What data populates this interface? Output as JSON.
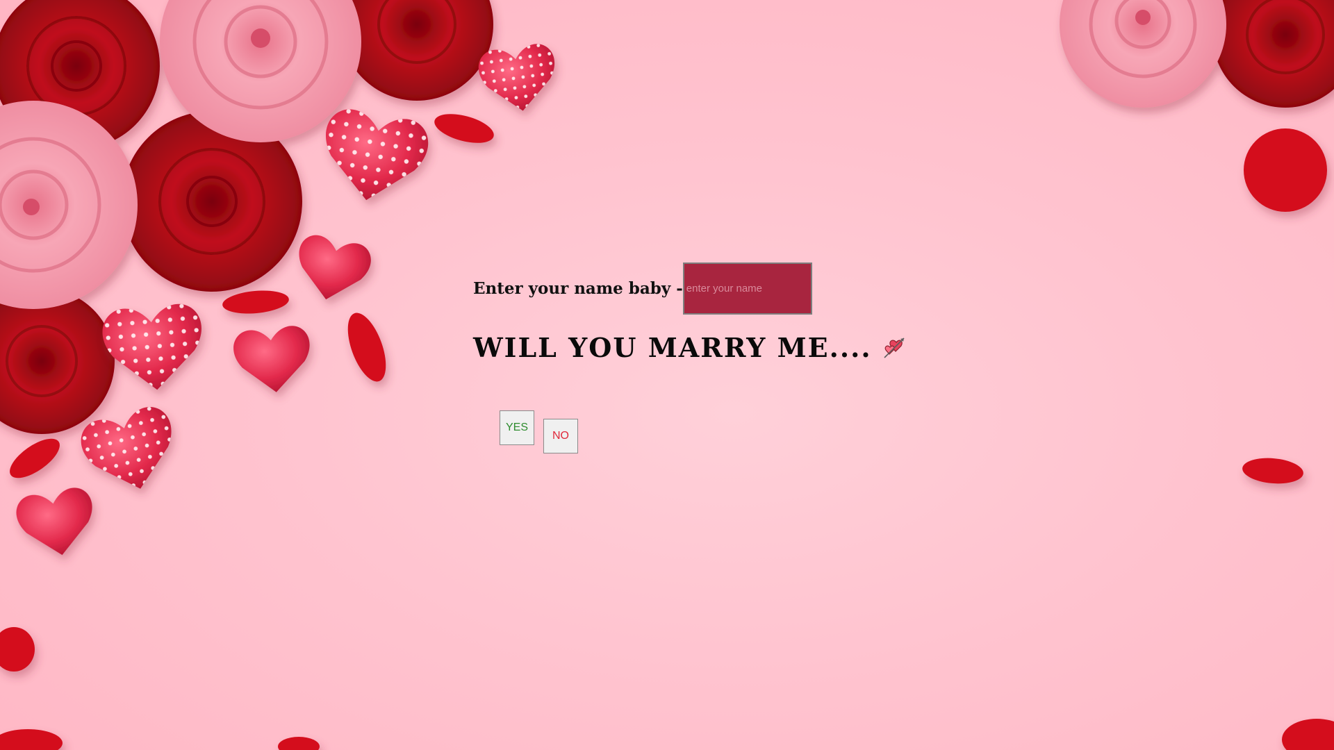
{
  "form": {
    "name_label": "Enter your name baby -",
    "name_value": "",
    "name_placeholder": "enter your name"
  },
  "question": {
    "text": "WILL YOU MARRY ME....",
    "emoji_icon": "hearts-arrow-icon"
  },
  "buttons": {
    "yes_label": "YES",
    "no_label": "NO"
  },
  "colors": {
    "background": "#ffc3cf",
    "input_fill": "#a8253f",
    "yes_text": "#2e8b2e",
    "no_text": "#e0283a"
  }
}
